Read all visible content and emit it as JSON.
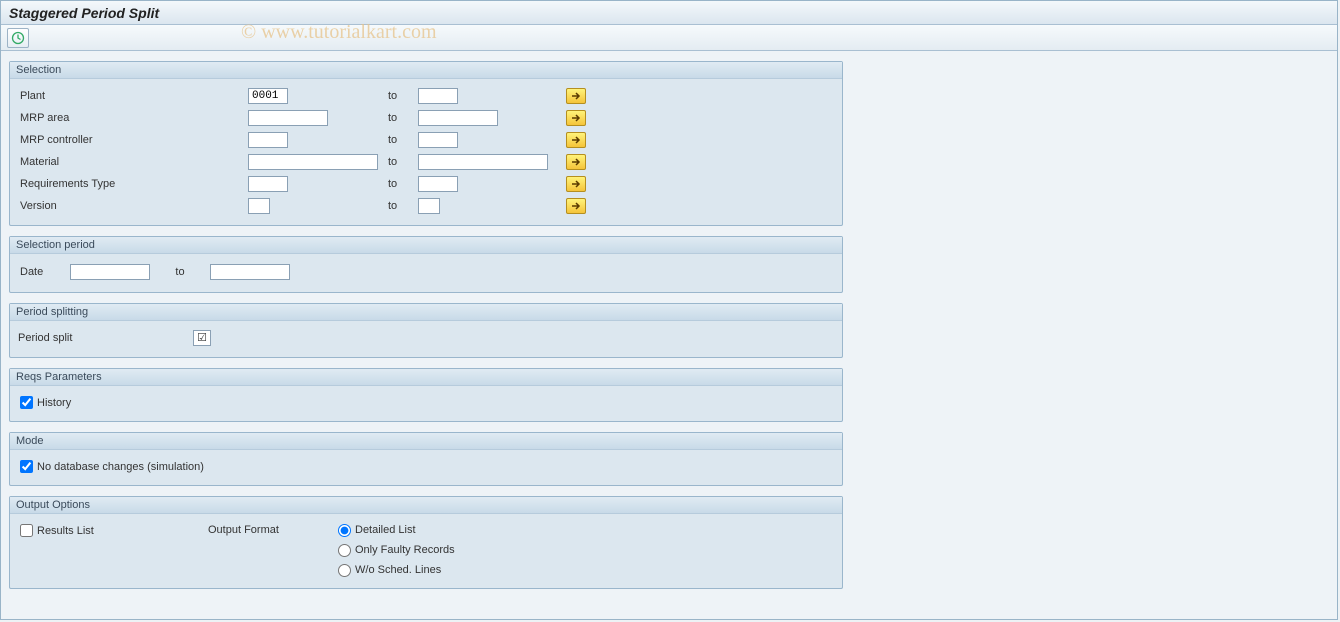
{
  "title": "Staggered Period Split",
  "watermark": "© www.tutorialkart.com",
  "groups": {
    "selection": {
      "title": "Selection",
      "rows": [
        {
          "label": "Plant",
          "from": "0001",
          "from_w": "w-short",
          "to": "",
          "to_w": "w-short"
        },
        {
          "label": "MRP area",
          "from": "",
          "from_w": "w-med",
          "to": "",
          "to_w": "w-med"
        },
        {
          "label": "MRP controller",
          "from": "",
          "from_w": "w-short",
          "to": "",
          "to_w": "w-short"
        },
        {
          "label": "Material",
          "from": "",
          "from_w": "w-long",
          "to": "",
          "to_w": "w-long"
        },
        {
          "label": "Requirements Type",
          "from": "",
          "from_w": "w-short",
          "to": "",
          "to_w": "w-short"
        },
        {
          "label": "Version",
          "from": "",
          "from_w": "w-short",
          "to": "",
          "to_w": "w-short"
        }
      ],
      "to_label": "to"
    },
    "sel_period": {
      "title": "Selection period",
      "date_label": "Date",
      "to_label": "to",
      "from": "",
      "to": ""
    },
    "period_split": {
      "title": "Period splitting",
      "label": "Period split",
      "checked": true
    },
    "reqs": {
      "title": "Reqs Parameters",
      "history_label": "History",
      "history_checked": true
    },
    "mode": {
      "title": "Mode",
      "sim_label": "No database changes (simulation)",
      "sim_checked": true
    },
    "output": {
      "title": "Output Options",
      "results_label": "Results List",
      "results_checked": false,
      "format_label": "Output Format",
      "options": [
        {
          "label": "Detailed List",
          "checked": true
        },
        {
          "label": "Only Faulty Records",
          "checked": false
        },
        {
          "label": "W/o Sched. Lines",
          "checked": false
        }
      ]
    }
  }
}
